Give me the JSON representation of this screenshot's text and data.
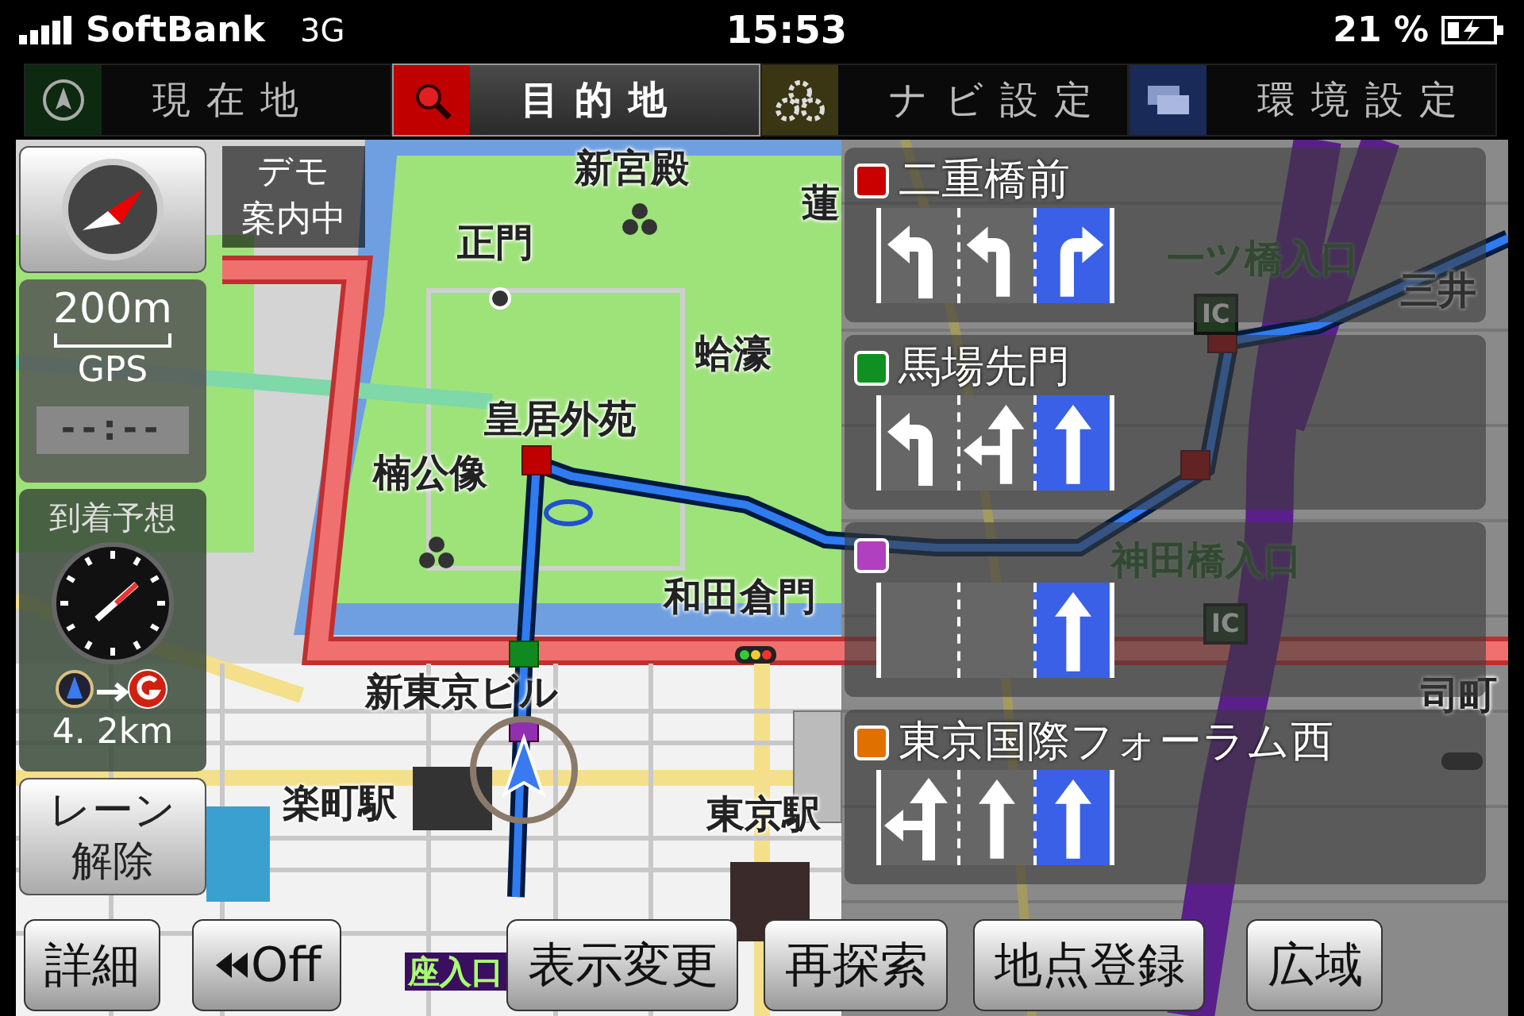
{
  "status_bar": {
    "carrier": "SoftBank",
    "network": "3G",
    "time": "15:53",
    "battery": "21 %"
  },
  "tabs": [
    {
      "label": "現在地",
      "kind": "location",
      "selected": false
    },
    {
      "label": "目的地",
      "kind": "destination",
      "selected": true
    },
    {
      "label": "ナビ設定",
      "kind": "navi",
      "selected": false
    },
    {
      "label": "環境設定",
      "kind": "settings",
      "selected": false
    }
  ],
  "map": {
    "demo_badge": [
      "デモ",
      "案内中"
    ],
    "labels": [
      {
        "text": "新宮殿",
        "kind": "place"
      },
      {
        "text": "正門",
        "kind": "place"
      },
      {
        "text": "蓮",
        "kind": "place"
      },
      {
        "text": "蛤濠",
        "kind": "place"
      },
      {
        "text": "皇居外苑",
        "kind": "place"
      },
      {
        "text": "楠公像",
        "kind": "place"
      },
      {
        "text": "和田倉門",
        "kind": "place"
      },
      {
        "text": "新東京ビル",
        "kind": "place"
      },
      {
        "text": "楽町駅",
        "kind": "place"
      },
      {
        "text": "東京駅",
        "kind": "place"
      },
      {
        "text": "一ツ橋入口",
        "kind": "interchange"
      },
      {
        "text": "三井",
        "kind": "place"
      },
      {
        "text": "神田橋入口",
        "kind": "interchange"
      },
      {
        "text": "司町",
        "kind": "place"
      },
      {
        "text": "座入口",
        "kind": "exit"
      },
      {
        "text": "IC",
        "kind": "ic"
      },
      {
        "text": "IC",
        "kind": "ic"
      }
    ]
  },
  "left_panel": {
    "scale": "200m",
    "positioning": "GPS",
    "clock": "--:--",
    "arrival_label": "到着予想",
    "distance": "4. 2km",
    "lane_button": [
      "レーン",
      "解除"
    ]
  },
  "lane_guide": [
    {
      "name": "二重橋前",
      "color": "#c80000",
      "lanes": [
        {
          "kind": "left",
          "selected": false
        },
        {
          "kind": "left",
          "selected": false
        },
        {
          "kind": "right",
          "selected": true
        }
      ]
    },
    {
      "name": "馬場先門",
      "color": "#109020",
      "lanes": [
        {
          "kind": "left",
          "selected": false
        },
        {
          "kind": "left-straight",
          "selected": false
        },
        {
          "kind": "straight",
          "selected": true
        }
      ]
    },
    {
      "color": "#b040c0",
      "lanes": [
        {
          "kind": "none",
          "selected": false
        },
        {
          "kind": "none",
          "selected": false
        },
        {
          "kind": "straight",
          "selected": true
        }
      ]
    },
    {
      "name": "東京国際フォーラム西",
      "color": "#e07000",
      "lanes": [
        {
          "kind": "left-straight",
          "selected": false
        },
        {
          "kind": "straight",
          "selected": false
        },
        {
          "kind": "straight",
          "selected": true
        }
      ]
    }
  ],
  "bottom_buttons": [
    {
      "label": "詳細",
      "kind": "text"
    },
    {
      "label": "Off",
      "kind": "rewind"
    },
    {
      "label": "表示変更",
      "kind": "text"
    },
    {
      "label": "再探索",
      "kind": "text"
    },
    {
      "label": "地点登録",
      "kind": "text"
    },
    {
      "label": "広域",
      "kind": "text"
    }
  ]
}
